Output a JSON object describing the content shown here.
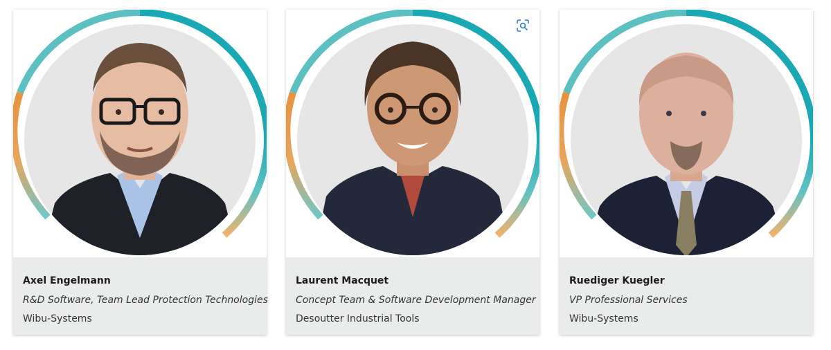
{
  "colors": {
    "teal": "#1aa9b4",
    "teal_light": "#6fc6c9",
    "orange": "#e8923c",
    "orange_light": "#f2b26c",
    "photo_bg": "#e6e6e6",
    "info_bg": "#eaeceb",
    "icon": "#2a7fd6"
  },
  "speakers": [
    {
      "name": "Axel Engelmann",
      "role": "R&D Software, Team Lead Protection Technologies",
      "company": "Wibu-Systems",
      "photo": "portrait-man-glasses-dark-blazer"
    },
    {
      "name": "Laurent Macquet",
      "role": "Concept Team & Software Development Manager",
      "company": "Desoutter Industrial Tools",
      "photo": "portrait-man-round-glasses-polo"
    },
    {
      "name": "Ruediger Kuegler",
      "role": "VP Professional Services",
      "company": "Wibu-Systems",
      "photo": "portrait-man-suit-tie"
    }
  ],
  "icons": {
    "visual_search": "visual-search-icon"
  }
}
